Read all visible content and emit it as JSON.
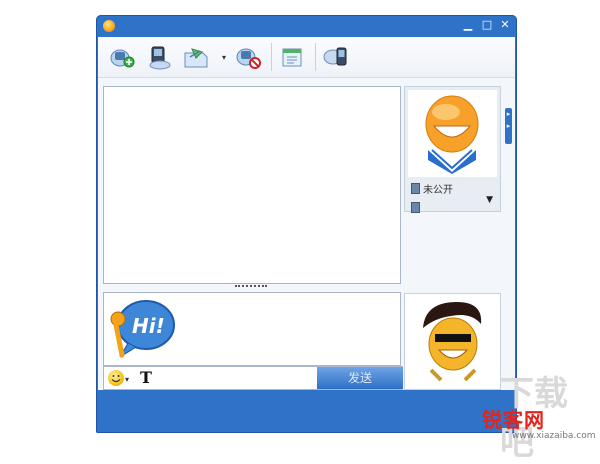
{
  "window": {
    "controls": {
      "minimize": "▁",
      "maximize": "□",
      "close": "✕"
    }
  },
  "toolbar": {
    "items": [
      {
        "icon": "video-call-icon"
      },
      {
        "icon": "voice-call-icon"
      },
      {
        "icon": "send-file-icon"
      },
      {
        "icon": "block-contact-icon"
      },
      {
        "icon": "message-history-icon"
      },
      {
        "icon": "send-sms-icon"
      }
    ]
  },
  "contact_panel": {
    "privacy_label": "未公开"
  },
  "input": {
    "hi_sticker_text": "Hi!"
  },
  "bottom_bar": {
    "font_label": "T",
    "send_label": "发送"
  },
  "watermark": {
    "brand": "锐客网",
    "url": "www.xiazaiba.com"
  },
  "colors": {
    "window_blue": "#2f73c8",
    "panel_border": "#a9b7c9",
    "send_button": "#2d6fc6",
    "watermark_red": "#e5231b"
  }
}
